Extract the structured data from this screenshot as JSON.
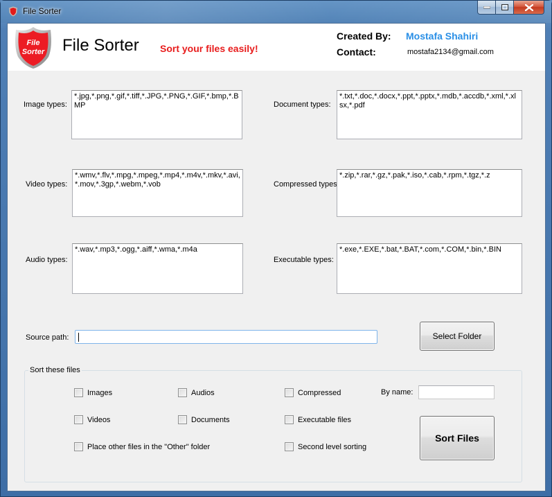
{
  "window": {
    "title": "File Sorter",
    "controls": {
      "minimize": "minimize",
      "maximize": "maximize",
      "close": "close"
    }
  },
  "header": {
    "logo_line1": "File",
    "logo_line2": "Sorter",
    "app_title": "File Sorter",
    "tagline": "Sort your files easily!",
    "created_by_label": "Created By:",
    "created_by_value": "Mostafa Shahiri",
    "contact_label": "Contact:",
    "contact_value": "mostafa2134@gmail.com"
  },
  "types": {
    "image": {
      "label": "Image types:",
      "value": "*.jpg,*.png,*.gif,*.tiff,*.JPG,*.PNG,*.GIF,*.bmp,*.BMP"
    },
    "document": {
      "label": "Document types:",
      "value": "*.txt,*.doc,*.docx,*.ppt,*.pptx,*.mdb,*.accdb,*.xml,*.xlsx,*.pdf"
    },
    "video": {
      "label": "Video types:",
      "value": "*.wmv,*.flv,*.mpg,*.mpeg,*.mp4,*.m4v,*.mkv,*.avi,*.mov,*.3gp,*.webm,*.vob"
    },
    "compressed": {
      "label": "Compressed types:",
      "value": "*.zip,*.rar,*.gz,*.pak,*.iso,*.cab,*.rpm,*.tgz,*.z"
    },
    "audio": {
      "label": "Audio types:",
      "value": "*.wav,*.mp3,*.ogg,*.aiff,*.wma,*.m4a"
    },
    "executable": {
      "label": "Executable types:",
      "value": "*.exe,*.EXE,*.bat,*.BAT,*.com,*.COM,*.bin,*.BIN"
    }
  },
  "source": {
    "label": "Source path:",
    "value": "",
    "select_button": "Select Folder"
  },
  "sort_group": {
    "legend": "Sort these files",
    "checkboxes": {
      "images": {
        "label": "Images",
        "checked": false
      },
      "audios": {
        "label": "Audios",
        "checked": false
      },
      "compressed": {
        "label": "Compressed",
        "checked": false
      },
      "videos": {
        "label": "Videos",
        "checked": false
      },
      "documents": {
        "label": "Documents",
        "checked": false
      },
      "executable": {
        "label": "Executable files",
        "checked": false
      },
      "other_folder": {
        "label": "Place other files in the \"Other\" folder",
        "checked": false
      },
      "second_level": {
        "label": "Second level sorting",
        "checked": false
      }
    },
    "by_name_label": "By name:",
    "by_name_value": "",
    "sort_button": "Sort Files"
  }
}
